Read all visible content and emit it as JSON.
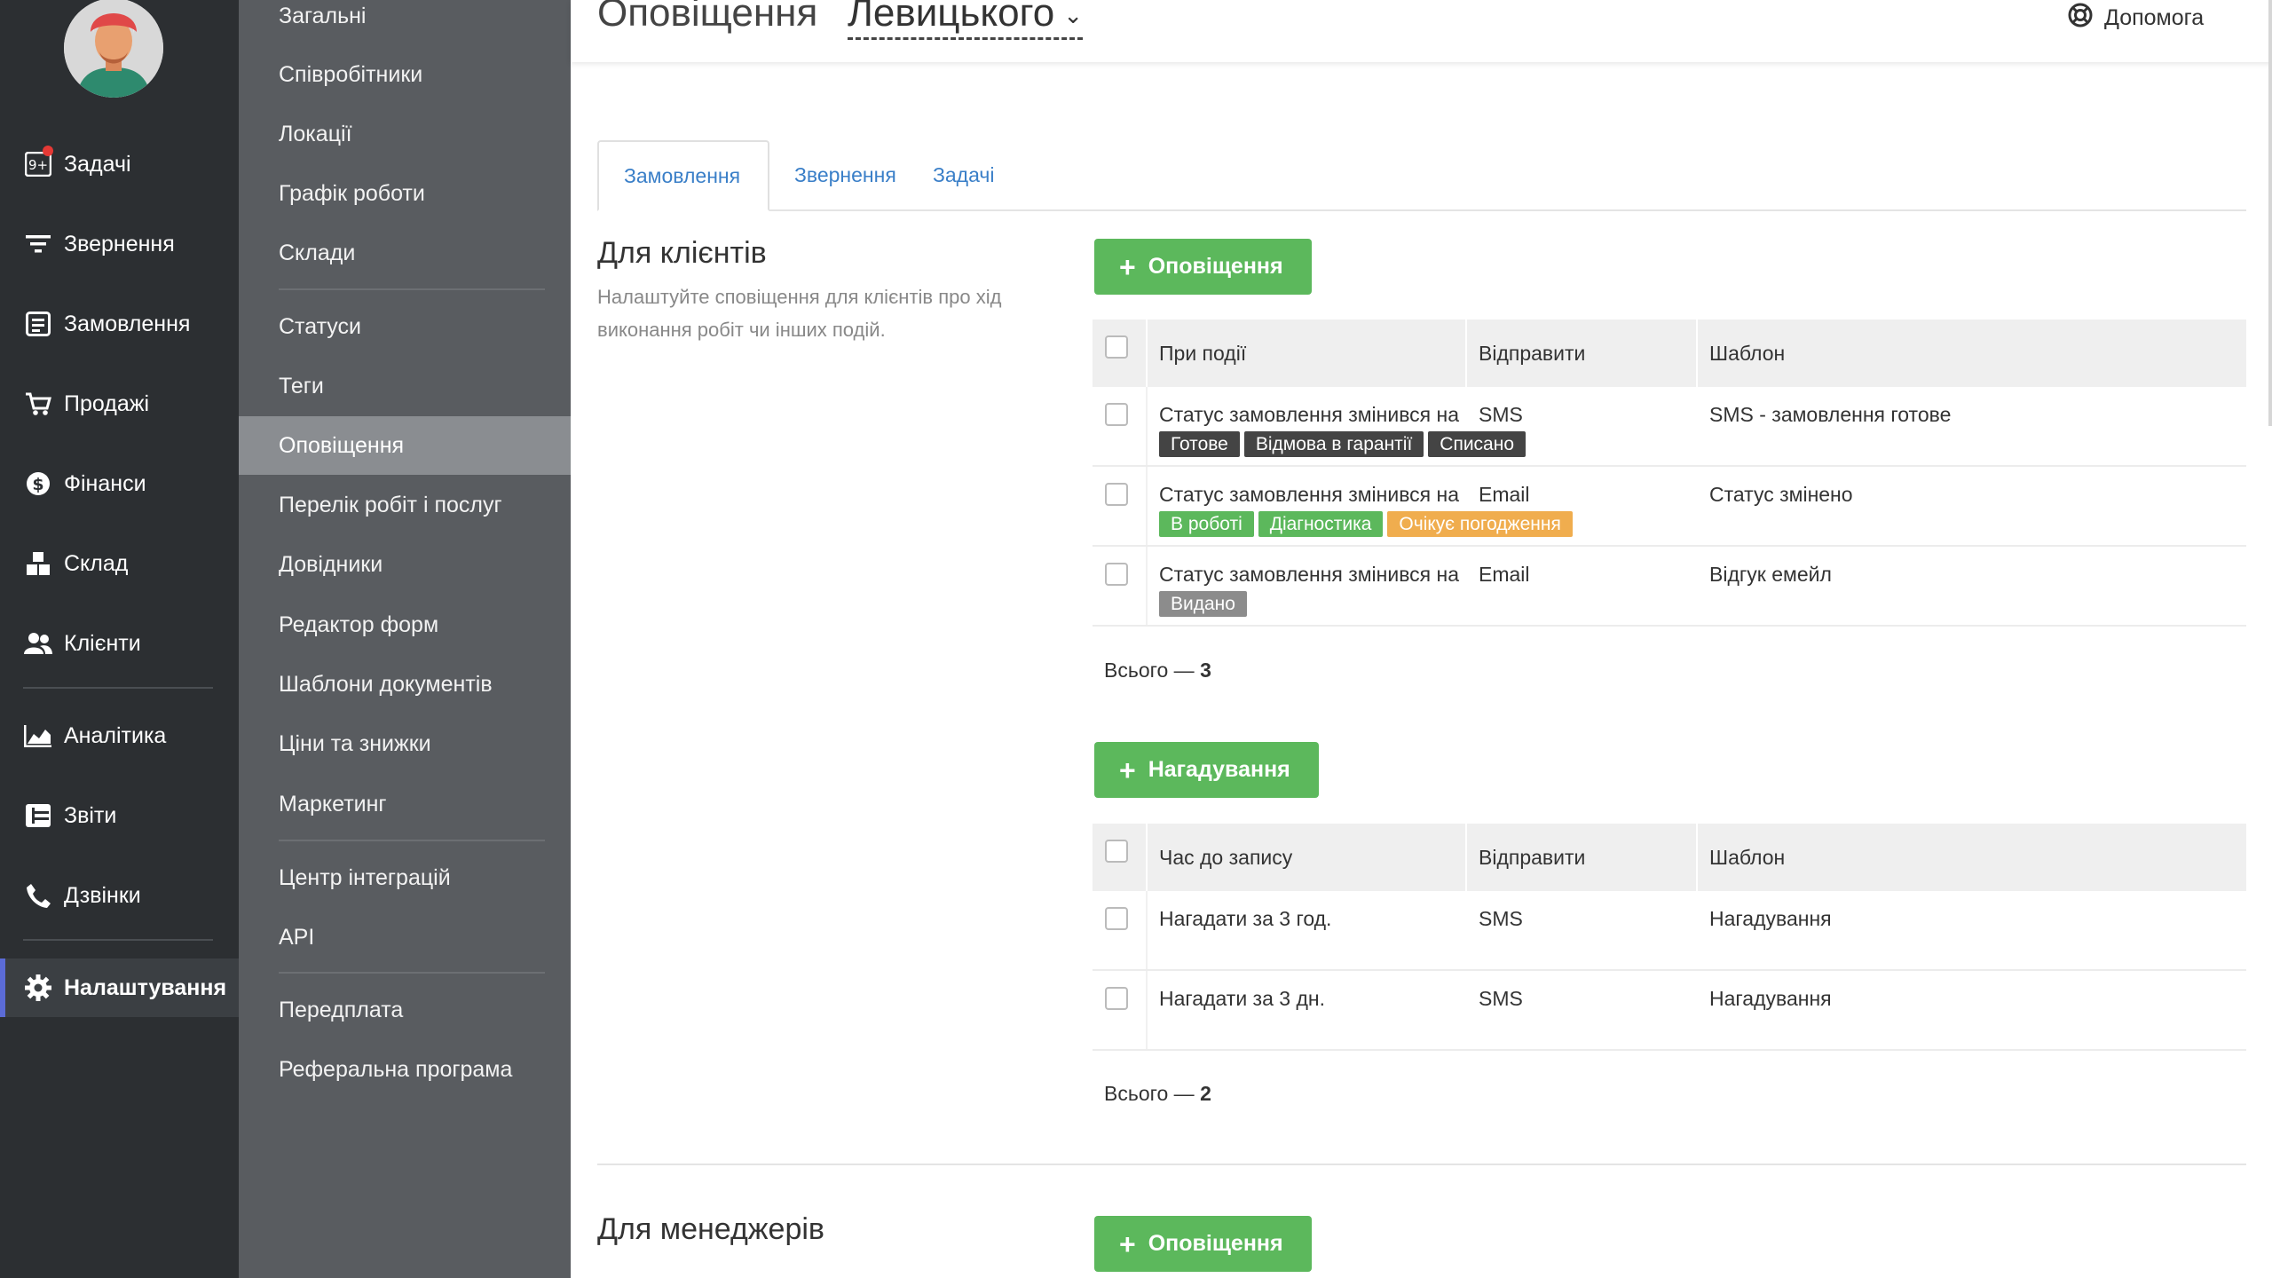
{
  "nav": {
    "items": [
      {
        "label": "Задачі",
        "icon": "tasks-icon",
        "badge": "9+"
      },
      {
        "label": "Звернення",
        "icon": "filter-icon"
      },
      {
        "label": "Замовлення",
        "icon": "orders-icon"
      },
      {
        "label": "Продажі",
        "icon": "cart-icon"
      },
      {
        "label": "Фінанси",
        "icon": "dollar-icon"
      },
      {
        "label": "Склад",
        "icon": "warehouse-icon"
      },
      {
        "label": "Клієнти",
        "icon": "clients-icon"
      },
      {
        "label": "Аналітика",
        "icon": "analytics-icon"
      },
      {
        "label": "Звіти",
        "icon": "reports-icon"
      },
      {
        "label": "Дзвінки",
        "icon": "phone-icon"
      },
      {
        "label": "Налаштування",
        "icon": "gear-icon"
      }
    ]
  },
  "submenu": {
    "items": [
      "Загальні",
      "Співробітники",
      "Локації",
      "Графік роботи",
      "Склади",
      "Статуси",
      "Теги",
      "Оповіщення",
      "Перелік робіт і послуг",
      "Довідники",
      "Редактор форм",
      "Шаблони документів",
      "Ціни та знижки",
      "Маркетинг",
      "Центр інтеграцій",
      "API",
      "Передплата",
      "Реферальна програма"
    ]
  },
  "header": {
    "title": "Оповіщення",
    "company": "Левицького",
    "help": "Допомога"
  },
  "tabs": [
    "Замовлення",
    "Звернення",
    "Задачі"
  ],
  "clients": {
    "title": "Для клієнтів",
    "description": "Налаштуйте сповіщення для клієнтів про хід виконання робіт чи інших подій.",
    "add_button": "Оповіщення",
    "headers": {
      "event": "При події",
      "send": "Відправити",
      "template": "Шаблон"
    },
    "rows": [
      {
        "event": "Статус замовлення змінився на",
        "tags": [
          {
            "text": "Готове",
            "color": "#444444"
          },
          {
            "text": "Відмова в гарантії",
            "color": "#444444"
          },
          {
            "text": "Списано",
            "color": "#444444"
          }
        ],
        "send": "SMS",
        "template": "SMS - замовлення готове"
      },
      {
        "event": "Статус замовлення змінився на",
        "tags": [
          {
            "text": "В роботі",
            "color": "#5cb85c"
          },
          {
            "text": "Діагностика",
            "color": "#5cb85c"
          },
          {
            "text": "Очікує погодження",
            "color": "#f0ad4e"
          }
        ],
        "send": "Email",
        "template": "Статус змінено"
      },
      {
        "event": "Статус замовлення змінився на",
        "tags": [
          {
            "text": "Видано",
            "color": "#8c8c8c"
          }
        ],
        "send": "Email",
        "template": "Відгук емейл"
      }
    ],
    "total_label": "Всього —",
    "total_value": "3"
  },
  "reminders": {
    "add_button": "Нагадування",
    "headers": {
      "event": "Час до запису",
      "send": "Відправити",
      "template": "Шаблон"
    },
    "rows": [
      {
        "event": "Нагадати за 3 год.",
        "send": "SMS",
        "template": "Нагадування"
      },
      {
        "event": "Нагадати за 3 дн.",
        "send": "SMS",
        "template": "Нагадування"
      }
    ],
    "total_label": "Всього —",
    "total_value": "2"
  },
  "managers": {
    "title": "Для менеджерів",
    "add_button": "Оповіщення"
  }
}
